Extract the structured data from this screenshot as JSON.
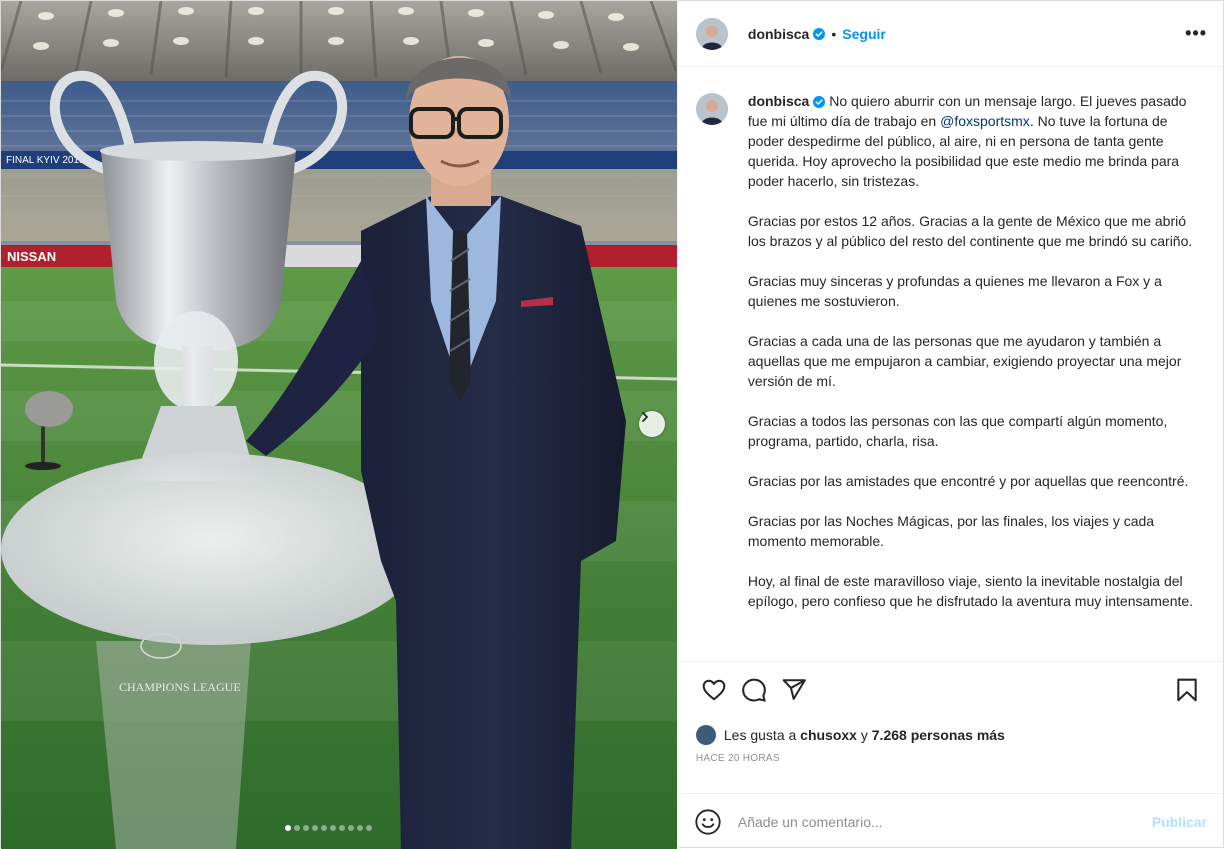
{
  "post": {
    "username": "donbisca",
    "follow_label": "Seguir",
    "separator": "•",
    "more_label": "•••"
  },
  "caption": {
    "username": "donbisca",
    "intro": "No quiero aburrir con un mensaje largo. El jueves pasado fue mi último día de trabajo en",
    "mention": "@foxsportsmx",
    "intro_rest": ". No tuve la fortuna de poder despedirme del público, al aire, ni en persona de tanta gente querida. Hoy aprovecho la posibilidad que este medio me brinda para poder hacerlo, sin tristezas.",
    "paragraphs": [
      "Gracias por estos 12 años. Gracias a la gente de México que me abrió los brazos y al público del resto del continente que me brindó su cariño.",
      "Gracias muy sinceras y profundas a quienes me llevaron a Fox y a quienes me sostuvieron.",
      "Gracias a cada una de las personas que me ayudaron y también a aquellas que me empujaron a cambiar, exigiendo proyectar una mejor versión de mí.",
      "Gracias a todos las personas con las que compartí algún momento, programa, partido, charla, risa.",
      "Gracias por las amistades que encontré y por aquellas que reencontré.",
      "Gracias por las Noches Mágicas, por las finales, los viajes y cada momento memorable.",
      "Hoy, al final de este maravilloso viaje, siento la inevitable nostalgia del epílogo, pero confieso que he disfrutado la aventura muy intensamente."
    ]
  },
  "likes": {
    "prefix": "Les gusta a",
    "user": "chusoxx",
    "middle": "y",
    "count": "7.268 personas más"
  },
  "timestamp": "HACE 20 HORAS",
  "comment": {
    "placeholder": "Añade un comentario...",
    "publish_label": "Publicar"
  },
  "media": {
    "trophy_base_text": "CHAMPIONS LEAGUE",
    "banner_text": "FINAL KYIV 2018",
    "board_text": "NISSAN",
    "carousel_total": 10,
    "carousel_active": 1
  },
  "colors": {
    "accent": "#0095f6",
    "publish_disabled": "#b2dffc",
    "mention": "#00376b"
  }
}
